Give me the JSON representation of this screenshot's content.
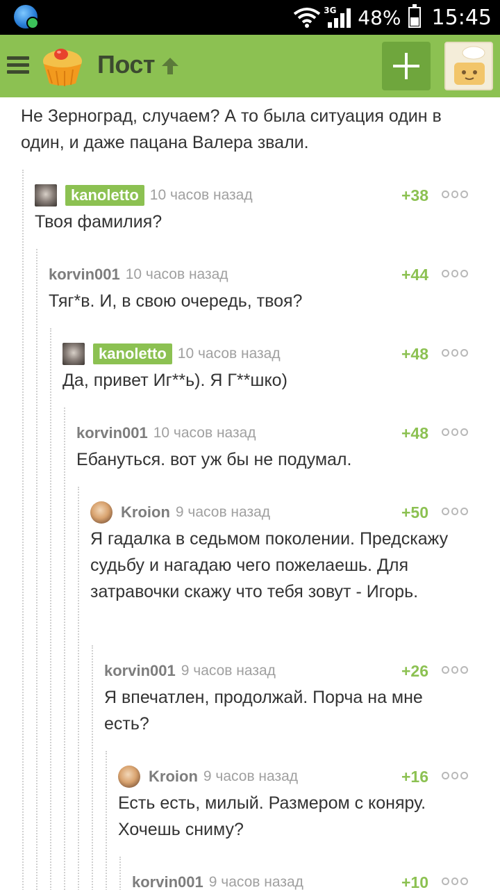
{
  "status_bar": {
    "network": "3G",
    "battery": "48%",
    "time": "15:45"
  },
  "app_bar": {
    "title": "Пост",
    "add_icon": "plus-icon",
    "menu_icon": "hamburger-icon"
  },
  "colors": {
    "accent": "#8cc152",
    "accent_dark": "#6fa63d",
    "rating": "#8cc152",
    "username": "#7d7d7d"
  },
  "top_comment_tail": "Не Зерноград, случаем? А то была ситуация один в один, и даже пацана Валера звали.",
  "comments": [
    {
      "user": "kanoletto",
      "time": "10 часов назад",
      "rating": "+38",
      "text": "Твоя фамилия?"
    },
    {
      "user": "korvin001",
      "time": "10 часов назад",
      "rating": "+44",
      "text": "Тяг*в. И, в свою очередь, твоя?"
    },
    {
      "user": "kanoletto",
      "time": "10 часов назад",
      "rating": "+48",
      "text": "Да, привет Иг**ь). Я Г**шко)"
    },
    {
      "user": "korvin001",
      "time": "10 часов назад",
      "rating": "+48",
      "text": "Ебануться. вот уж бы не подумал."
    },
    {
      "user": "Kroion",
      "time": "9 часов назад",
      "rating": "+50",
      "text": "Я гадалка в седьмом поколении. Предскажу судьбу и нагадаю чего пожелаешь. Для затравочки скажу что тебя зовут - Игорь."
    },
    {
      "user": "korvin001",
      "time": "9 часов назад",
      "rating": "+26",
      "text": "Я впечатлен, продолжай. Порча на мне есть?"
    },
    {
      "user": "Kroion",
      "time": "9 часов назад",
      "rating": "+16",
      "text": "Есть есть, милый. Размером с коняру. Хочешь сниму?"
    },
    {
      "user": "korvin001",
      "time": "9 часов назад",
      "rating": "+10",
      "text": ""
    }
  ]
}
